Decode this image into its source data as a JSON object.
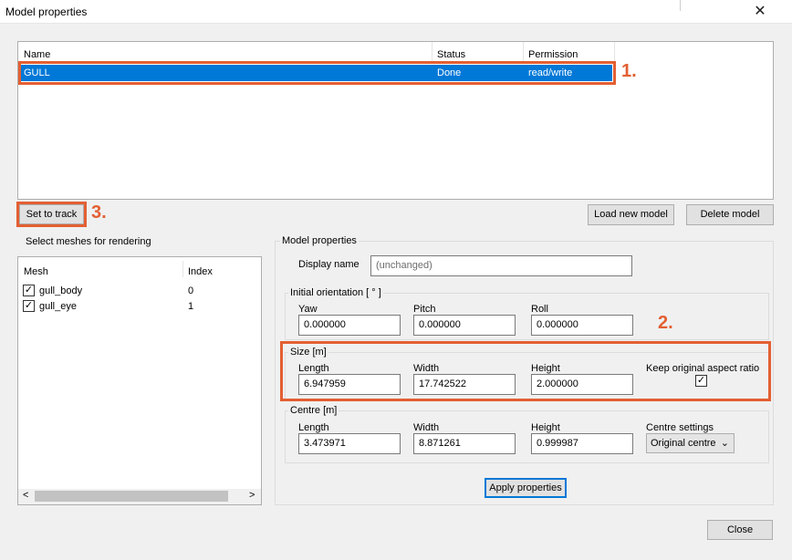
{
  "window": {
    "title": "Model properties",
    "close_glyph": "✕"
  },
  "models": {
    "columns": [
      "Name",
      "Status",
      "Permission"
    ],
    "rows": [
      {
        "name": "GULL",
        "status": "Done",
        "permission": "read/write"
      }
    ]
  },
  "annotations": {
    "c1": "1.",
    "c2": "2.",
    "c3": "3.",
    "color": "#e35f32"
  },
  "buttons": {
    "set_to_track": "Set to track",
    "load_new_model": "Load new model",
    "delete_model": "Delete model",
    "apply_properties": "Apply properties",
    "close": "Close"
  },
  "meshes": {
    "group_title": "Select meshes for rendering",
    "columns": [
      "Mesh",
      "Index"
    ],
    "rows": [
      {
        "name": "gull_body",
        "index": "0",
        "checked": true
      },
      {
        "name": "gull_eye",
        "index": "1",
        "checked": true
      }
    ],
    "scroll_left": "<",
    "scroll_right": ">"
  },
  "props": {
    "group_title": "Model properties",
    "display_name_label": "Display name",
    "display_name_value": "(unchanged)",
    "orientation": {
      "title": "Initial orientation [ ° ]",
      "yaw_label": "Yaw",
      "yaw": "0.000000",
      "pitch_label": "Pitch",
      "pitch": "0.000000",
      "roll_label": "Roll",
      "roll": "0.000000"
    },
    "size": {
      "title": "Size [m]",
      "length_label": "Length",
      "length": "6.947959",
      "width_label": "Width",
      "width": "17.742522",
      "height_label": "Height",
      "height": "2.000000",
      "keep_aspect_label": "Keep original aspect ratio",
      "keep_aspect_checked": true
    },
    "centre": {
      "title": "Centre [m]",
      "length_label": "Length",
      "length": "3.473971",
      "width_label": "Width",
      "width": "8.871261",
      "height_label": "Height",
      "height": "0.999987",
      "settings_label": "Centre settings",
      "settings_value": "Original centre"
    }
  },
  "check_glyph": "✓"
}
